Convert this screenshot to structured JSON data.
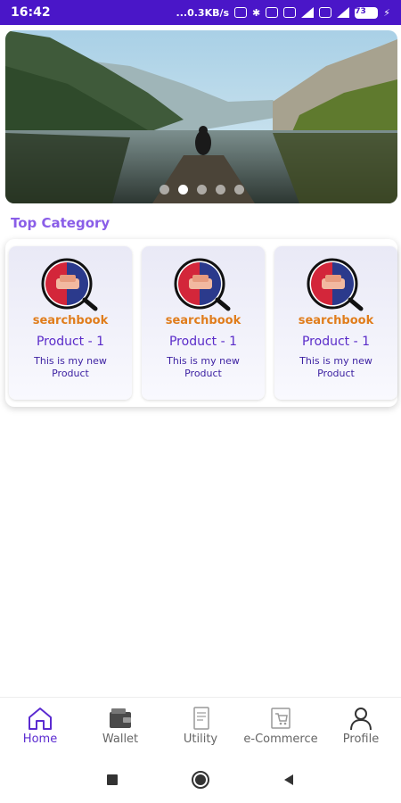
{
  "status_bar": {
    "time": "16:42",
    "network_speed": "...0.3KB/s",
    "battery": "73"
  },
  "banner": {
    "slide_count": 5,
    "active_index": 1
  },
  "section": {
    "title": "Top Category"
  },
  "products": [
    {
      "brand": "searchbook",
      "name": "Product - 1",
      "description": "This is my new Product"
    },
    {
      "brand": "searchbook",
      "name": "Product - 1",
      "description": "This is my new Product"
    },
    {
      "brand": "searchbook",
      "name": "Product - 1",
      "description": "This is my new Product"
    }
  ],
  "nav": {
    "home": "Home",
    "wallet": "Wallet",
    "utility": "Utility",
    "ecommerce": "e-Commerce",
    "profile": "Profile"
  },
  "colors": {
    "status_bar": "#4a16c8",
    "accent": "#5b2bd0",
    "section_title": "#8a5ee8",
    "brand": "#e07d1c"
  }
}
